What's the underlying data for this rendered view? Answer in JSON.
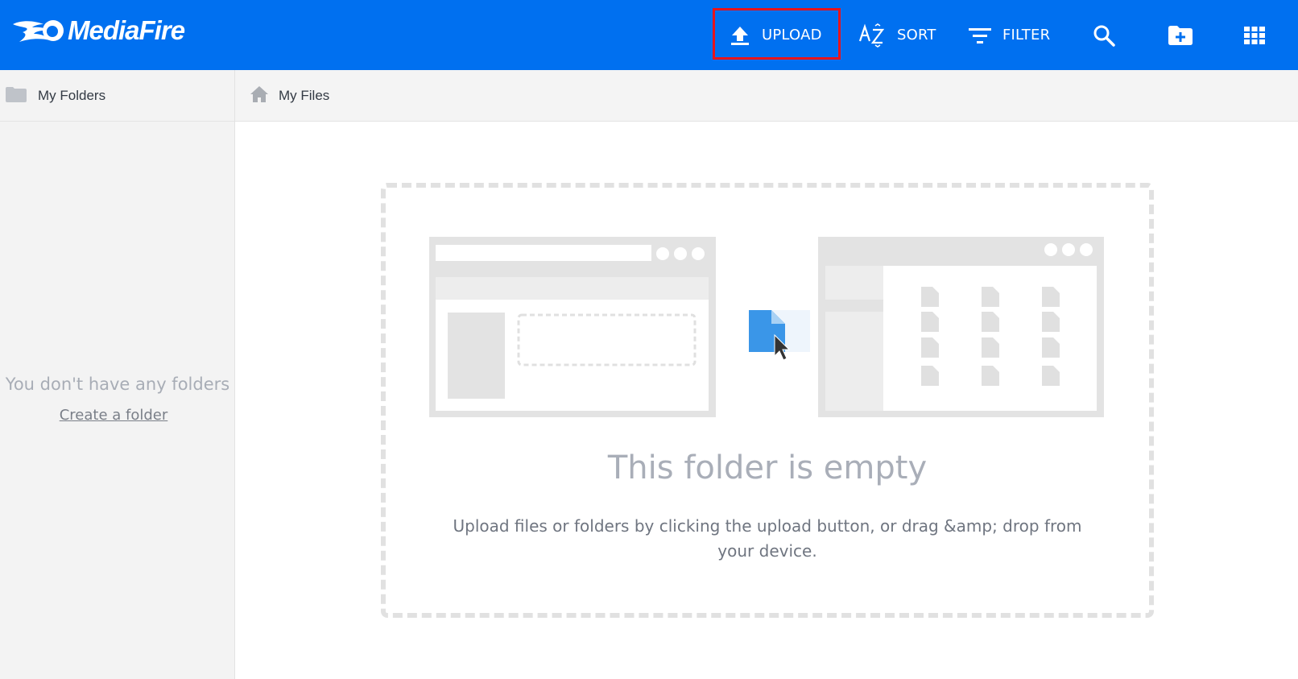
{
  "app": {
    "brand": "MediaFire"
  },
  "toolbar": {
    "upload_label": "UPLOAD",
    "sort_label": "SORT",
    "filter_label": "FILTER",
    "icons": {
      "upload": "upload-icon",
      "sort": "sort-az-icon",
      "filter": "filter-icon",
      "search": "search-icon",
      "new_folder": "new-folder-icon",
      "view": "grid-view-icon"
    }
  },
  "sidebar": {
    "header_label": "My Folders",
    "empty_text": "You don't have any folders",
    "create_link": "Create a folder"
  },
  "breadcrumb": {
    "label": "My Files"
  },
  "main": {
    "empty_title": "This folder is empty",
    "empty_description": "Upload files or folders by clicking the upload button, or drag &amp; drop from your device."
  },
  "colors": {
    "topbar": "#0070f0",
    "highlight": "#e8141c",
    "accent_file": "#3a96e8"
  }
}
